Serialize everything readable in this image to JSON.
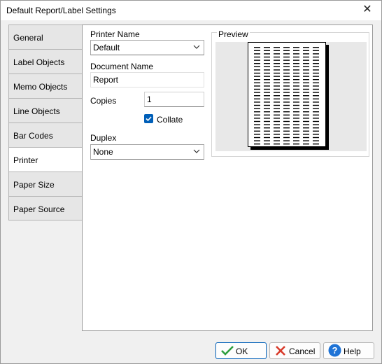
{
  "window": {
    "title": "Default Report/Label Settings",
    "close_glyph": "✕"
  },
  "tabs": [
    {
      "label": "General"
    },
    {
      "label": "Label Objects"
    },
    {
      "label": "Memo Objects"
    },
    {
      "label": "Line Objects"
    },
    {
      "label": "Bar Codes"
    },
    {
      "label": "Printer"
    },
    {
      "label": "Paper Size"
    },
    {
      "label": "Paper Source"
    }
  ],
  "active_tab": "Printer",
  "form": {
    "printer_name_label": "Printer Name",
    "printer_name_value": "Default",
    "document_name_label": "Document Name",
    "document_name_value": "Report",
    "copies_label": "Copies",
    "copies_value": "1",
    "collate_label": "Collate",
    "collate_checked": true,
    "duplex_label": "Duplex",
    "duplex_value": "None"
  },
  "preview": {
    "label": "Preview"
  },
  "buttons": {
    "ok_label": "OK",
    "cancel_label": "Cancel",
    "help_label": "Help"
  },
  "colors": {
    "accent": "#005fb8",
    "ok_icon": "#2e9e3e",
    "cancel_icon": "#d83b2b",
    "help_icon": "#1e73d6"
  },
  "icons": {
    "ok": "checkmark-icon",
    "cancel": "x-icon",
    "help": "question-icon",
    "close": "close-icon",
    "dropdown": "chevron-down-icon"
  }
}
